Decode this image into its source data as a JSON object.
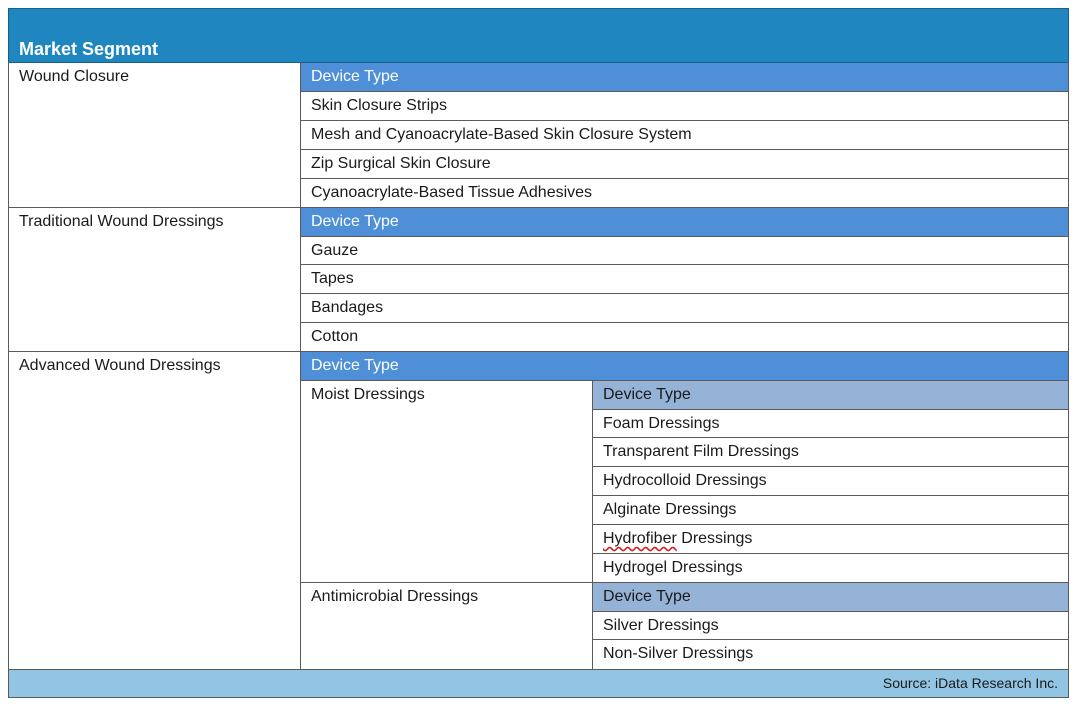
{
  "header": {
    "title": "Market Segment"
  },
  "segments": [
    {
      "name": "Wound Closure",
      "device_type_label": "Device Type",
      "items": [
        "Skin Closure Strips",
        "Mesh and Cyanoacrylate-Based Skin Closure System",
        "Zip Surgical Skin Closure",
        "Cyanoacrylate-Based Tissue Adhesives"
      ]
    },
    {
      "name": "Traditional Wound Dressings",
      "device_type_label": "Device Type",
      "items": [
        "Gauze",
        "Tapes",
        "Bandages",
        "Cotton"
      ]
    },
    {
      "name": "Advanced Wound Dressings",
      "device_type_label": "Device Type",
      "subgroups": [
        {
          "name": "Moist Dressings",
          "device_type_label": "Device Type",
          "items_prefix": [
            "Foam Dressings",
            "Transparent Film Dressings",
            "Hydrocolloid Dressings",
            "Alginate Dressings"
          ],
          "hydrofiber_word": "Hydrofiber",
          "hydrofiber_rest": " Dressings",
          "items_suffix": [
            "Hydrogel Dressings"
          ]
        },
        {
          "name": "Antimicrobial Dressings",
          "device_type_label": "Device Type",
          "items": [
            "Silver Dressings",
            "Non-Silver Dressings"
          ]
        }
      ]
    }
  ],
  "footer": {
    "source": "Source: iData Research Inc."
  },
  "colors": {
    "header_bg": "#1f86bf",
    "device_type_bg": "#4f8fd8",
    "sub_device_type_bg": "#95b3d7",
    "footer_bg": "#92c5e4"
  }
}
